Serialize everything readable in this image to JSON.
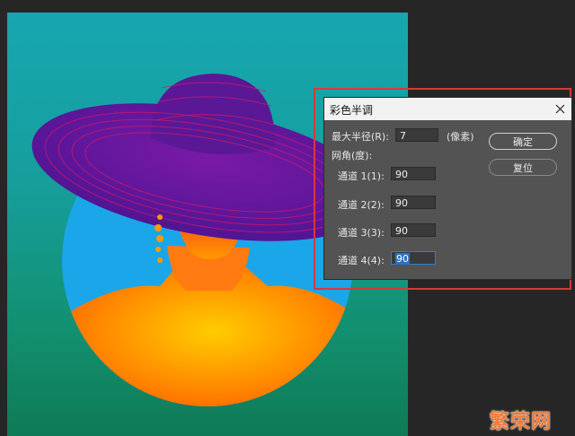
{
  "dialog": {
    "title": "彩色半调",
    "max_radius_label": "最大半径(R):",
    "max_radius_value": "7",
    "max_radius_unit": "(像素)",
    "screen_angles_label": "网角(度):",
    "channels": [
      {
        "label": "通道 1(1):",
        "value": "90"
      },
      {
        "label": "通道 2(2):",
        "value": "90"
      },
      {
        "label": "通道 3(3):",
        "value": "90"
      },
      {
        "label": "通道 4(4):",
        "value": "90"
      }
    ],
    "ok_label": "确定",
    "reset_label": "复位"
  },
  "watermark": "繁荣网",
  "colors": {
    "highlight_border": "#d8383b",
    "dialog_bg": "#535353",
    "titlebar_bg": "#f2f2f2",
    "watermark": "#f07b3a"
  },
  "icons": {
    "close": "close-icon"
  }
}
